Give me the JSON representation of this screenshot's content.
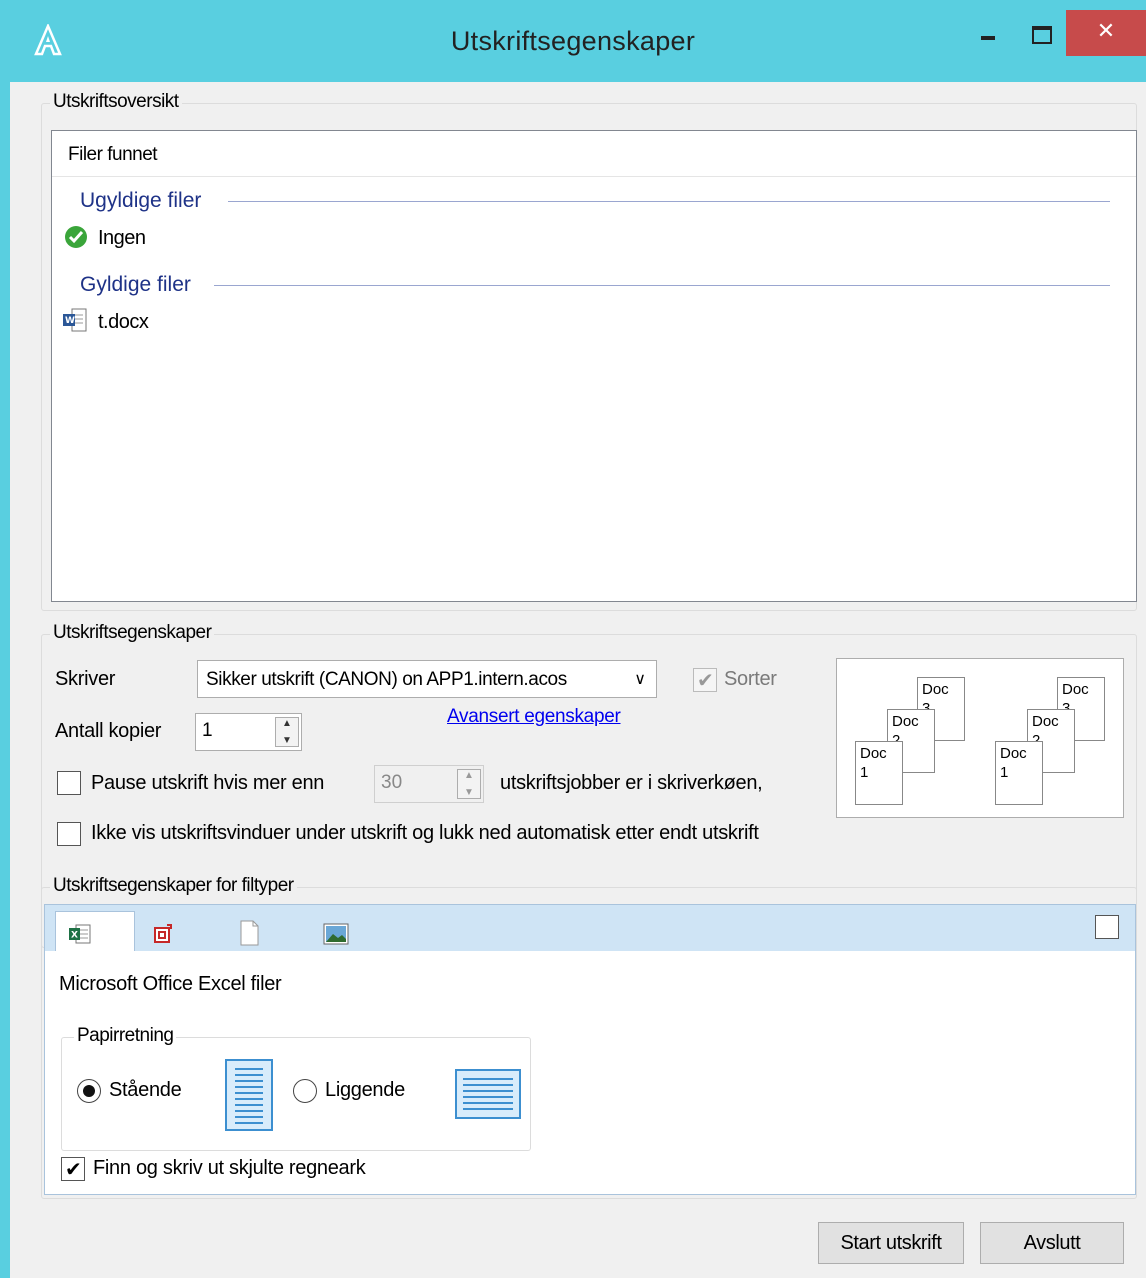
{
  "window": {
    "title": "Utskriftsegenskaper"
  },
  "overview": {
    "legend": "Utskriftsoversikt",
    "column_header": "Filer funnet",
    "groups": [
      {
        "title": "Ugyldige filer",
        "items": [
          "Ingen"
        ]
      },
      {
        "title": "Gyldige filer",
        "items": [
          "t.docx"
        ]
      }
    ]
  },
  "print_props": {
    "legend": "Utskriftsegenskaper",
    "printer_label": "Skriver",
    "printer_value": "Sikker utskrift (CANON) on APP1.intern.acos",
    "sort_label": "Sorter",
    "sort_checked": true,
    "advanced_link": "Avansert egenskaper",
    "copies_label": "Antall kopier",
    "copies_value": "1",
    "pause_label_before": "Pause utskrift hvis mer enn",
    "pause_value": "30",
    "pause_label_after": "utskriftsjobber er i skriverkøen,",
    "pause_checked": false,
    "hide_windows_label": "Ikke vis utskriftsvinduer under utskrift og lukk ned automatisk etter endt utskrift",
    "hide_windows_checked": false,
    "collate_pages": [
      {
        "text": "Doc",
        "num": "1"
      },
      {
        "text": "Doc",
        "num": "2"
      },
      {
        "text": "Doc",
        "num": "3"
      }
    ]
  },
  "filetypes": {
    "legend": "Utskriftsegenskaper for filtyper",
    "tabs": [
      {
        "name": "excel-tab",
        "icon": "excel-icon"
      },
      {
        "name": "pdf-tab",
        "icon": "pdf-icon"
      },
      {
        "name": "text-tab",
        "icon": "document-icon"
      },
      {
        "name": "image-tab",
        "icon": "image-icon"
      }
    ],
    "active_panel_title": "Microsoft Office Excel filer",
    "orientation_legend": "Papirretning",
    "portrait_label": "Stående",
    "landscape_label": "Liggende",
    "orientation_selected": "portrait",
    "hidden_sheets_label": "Finn og skriv ut skjulte regneark",
    "hidden_sheets_checked": true
  },
  "buttons": {
    "start": "Start utskrift",
    "exit": "Avslutt"
  }
}
